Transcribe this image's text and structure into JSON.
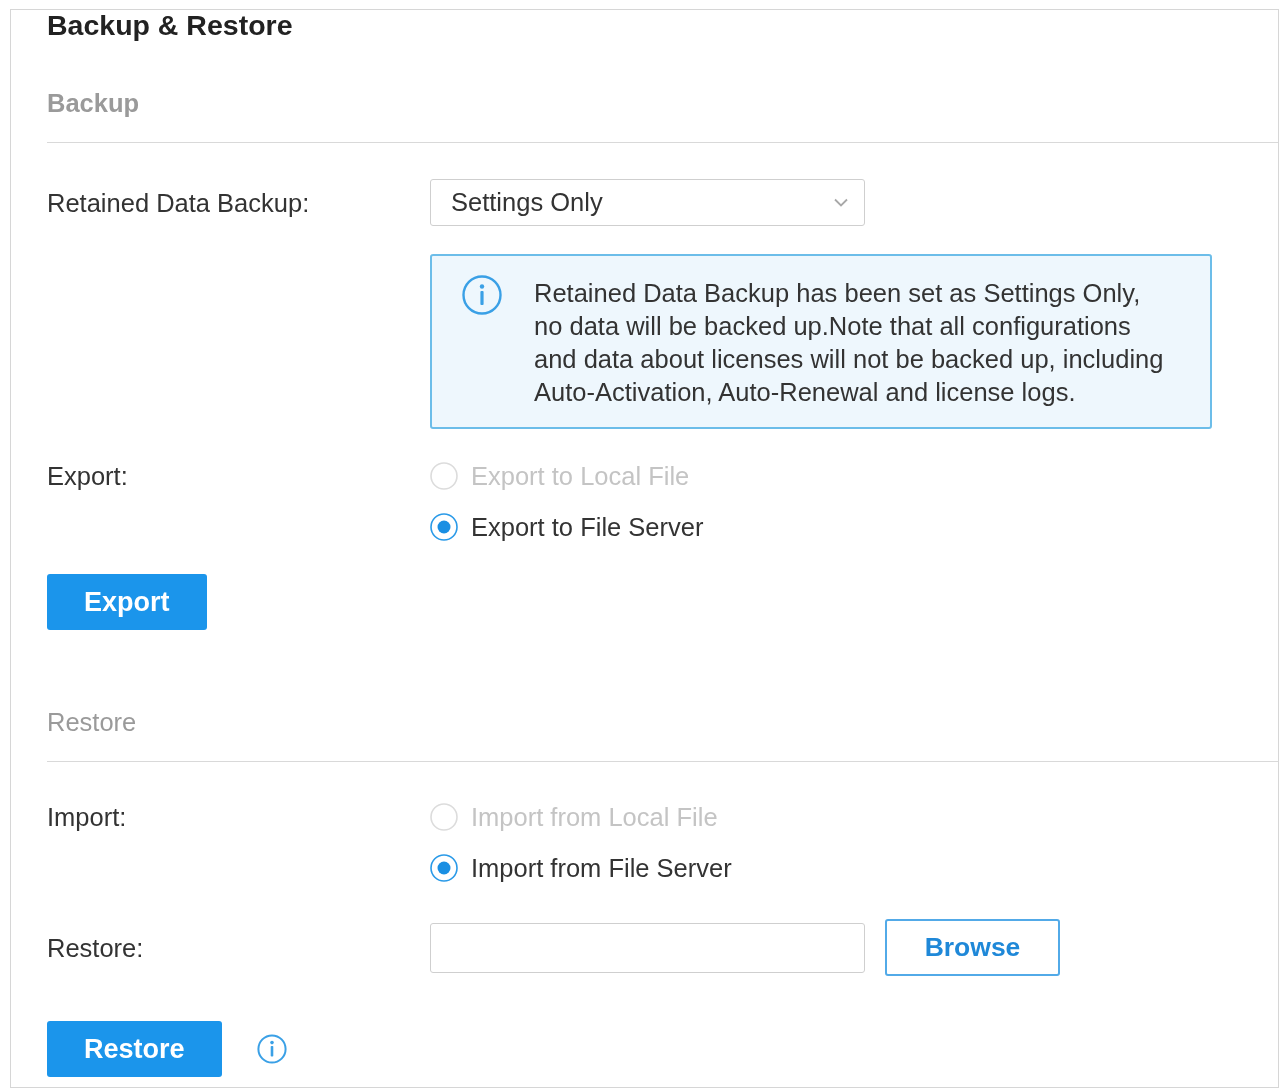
{
  "title": "Backup & Restore",
  "sections": [
    {
      "heading": "Backup",
      "rows": [
        {
          "kind": "select",
          "label": "Retained Data Backup:",
          "value": "Settings Only"
        },
        {
          "kind": "notice",
          "text": "Retained Data Backup has been set as Settings Only, no data will be backed up.Note that all configurations and data about licenses will not be backed up, including Auto-Activation, Auto-Renewal and license logs."
        },
        {
          "kind": "radio",
          "label": "Export:",
          "options": [
            {
              "label": "Export to Local File",
              "selected": false,
              "disabled": true
            },
            {
              "label": "Export to File Server",
              "selected": true,
              "disabled": false
            }
          ]
        },
        {
          "kind": "action",
          "button": "Export"
        }
      ]
    },
    {
      "heading": "Restore",
      "rows": [
        {
          "kind": "radio",
          "label": "Import:",
          "options": [
            {
              "label": "Import from Local File",
              "selected": false,
              "disabled": true
            },
            {
              "label": "Import from File Server",
              "selected": true,
              "disabled": false
            }
          ]
        },
        {
          "kind": "file",
          "label": "Restore:",
          "button": "Browse"
        },
        {
          "kind": "action",
          "button": "Restore",
          "info": true
        }
      ]
    }
  ]
}
